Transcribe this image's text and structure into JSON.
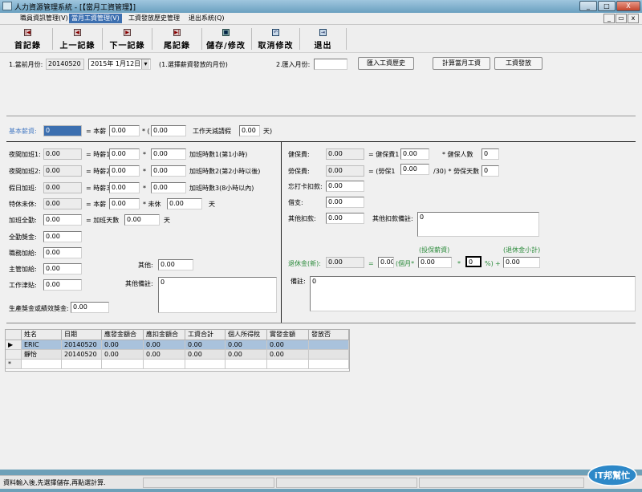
{
  "window": {
    "title": "人力資源管理系統 - [【當月工資管理】]",
    "minimize": "_",
    "maximize": "□",
    "close": "X"
  },
  "menubar": {
    "items": [
      {
        "label": "職員資訊管理(V)"
      },
      {
        "label": "當月工資管理(V)"
      },
      {
        "label": "工資發放歷史管理"
      },
      {
        "label": "退出系統(Q)"
      }
    ],
    "mdi_min": "_",
    "mdi_restore": "▭",
    "mdi_close": "x"
  },
  "toolbar": {
    "buttons": [
      {
        "label": "首記錄",
        "icon": "first-record-icon",
        "glyph": "|◀"
      },
      {
        "label": "上一記錄",
        "icon": "prev-record-icon",
        "glyph": "◀"
      },
      {
        "label": "下一記錄",
        "icon": "next-record-icon",
        "glyph": "▶"
      },
      {
        "label": "尾記錄",
        "icon": "last-record-icon",
        "glyph": "▶|"
      },
      {
        "label": "儲存/修改",
        "icon": "save-icon",
        "glyph": "■"
      },
      {
        "label": "取消修改",
        "icon": "undo-icon",
        "glyph": "↶"
      },
      {
        "label": "退出",
        "icon": "exit-icon",
        "glyph": "⇥"
      }
    ]
  },
  "top": {
    "current_month_label": "1.當前月份:",
    "current_month_value": "20140520",
    "date_picker": "2015年  1月12日",
    "hint": "(1.選擇薪資發放的月份)",
    "import_month_label": "2.匯入月份:",
    "import_month_value": "",
    "btn_import_history": "匯入工資歷史",
    "btn_calc": "計算當月工資",
    "btn_pay": "工資發放"
  },
  "base": {
    "label": "基本薪資:",
    "value": "0",
    "eq_label": "= 本薪",
    "salary": "0.00",
    "mult_label": "* (",
    "ratio": "0.00",
    "deduct_label": "工作天減請假",
    "days": "0.00",
    "days_unit": "天)"
  },
  "left": {
    "night1_label": "夜間加班1:",
    "night1_value": "0.00",
    "night1_eq": "= 時薪1",
    "night1_rate": "0.00",
    "night1_mult": "*",
    "night1_hours": "0.00",
    "night1_note": "加班時數1(第1小時)",
    "night2_label": "夜間加班2:",
    "night2_value": "0.00",
    "night2_eq": "= 時薪2",
    "night2_rate": "0.00",
    "night2_mult": "*",
    "night2_hours": "0.00",
    "night2_note": "加班時數2(第2小時以後)",
    "holiday_label": "假日加班:",
    "holiday_value": "0.00",
    "holiday_eq": "= 時薪3",
    "holiday_rate": "0.00",
    "holiday_mult": "*",
    "holiday_hours": "0.00",
    "holiday_note": "加班時數3(8小時以內)",
    "special_label": "特休未休:",
    "special_value": "0.00",
    "special_eq": "= 本薪",
    "special_salary": "0.00",
    "special_mult": "* 未休",
    "special_days": "0.00",
    "special_unit": "天",
    "fullot_label": "加班全勤:",
    "fullot_value": "0.00",
    "fullot_eq": "= 加班天數",
    "fullot_days": "0.00",
    "fullot_unit": "天",
    "attendance_label": "全勤獎金:",
    "attendance_value": "0.00",
    "duty_label": "職務加給:",
    "duty_value": "0.00",
    "manager_label": "主管加給:",
    "manager_value": "0.00",
    "meal_label": "工作津貼:",
    "meal_value": "0.00",
    "other_label": "其他:",
    "other_value": "0.00",
    "other_note_label": "其他備註:",
    "other_note_value": "0",
    "bonus_label": "生產獎金或績效獎金:",
    "bonus_value": "0.00"
  },
  "right": {
    "health_label": "健保費:",
    "health_value": "0.00",
    "health_eq": "= 健保費1",
    "health_rate": "0.00",
    "health_mult": "* 健保人數",
    "health_count": "0",
    "labor_label": "勞保費:",
    "labor_value": "0.00",
    "labor_eq": "= (勞保1",
    "labor_rate": "0.00",
    "labor_div": "/30) * 勞保天數",
    "labor_days": "0",
    "clock_label": "忘打卡扣款:",
    "clock_value": "0.00",
    "loan_label": "借支:",
    "loan_value": "0.00",
    "otherdeduct_label": "其他扣款:",
    "otherdeduct_value": "0.00",
    "otherdeduct_note_label": "其他扣款備註:",
    "otherdeduct_note_value": "0",
    "pension_top1": "(投保薪資)",
    "pension_top2": "(退休金小計)",
    "pension_label": "退休金(新):",
    "pension_value": "0.00",
    "pension_eq": "=",
    "pension_sub": "0.00",
    "pension_month": "(個月*",
    "pension_insured": "0.00",
    "pension_mult": "*",
    "pension_pct": "0",
    "pension_pct_unit": "%)",
    "pension_plus": "+",
    "pension_total": "0.00",
    "remark_label": "備註:",
    "remark_value": "0"
  },
  "grid": {
    "columns": [
      "姓名",
      "日期",
      "應發金額合",
      "應扣金額合",
      "工資合計",
      "個人所得稅",
      "實發金額",
      "發放否"
    ],
    "rows": [
      {
        "marker": "▶",
        "cells": [
          "ERIC",
          "20140520",
          "0.00",
          "0.00",
          "0.00",
          "0.00",
          "0.00",
          ""
        ]
      },
      {
        "marker": "",
        "cells": [
          "靜怡",
          "20140520",
          "0.00",
          "0.00",
          "0.00",
          "0.00",
          "0.00",
          ""
        ]
      },
      {
        "marker": "*",
        "cells": [
          "",
          "",
          "",
          "",
          "",
          "",
          "",
          ""
        ]
      }
    ]
  },
  "status": {
    "message": "資料輸入後,先選擇儲存,再點選計算."
  },
  "watermark": {
    "text": "iT邦幫忙"
  }
}
